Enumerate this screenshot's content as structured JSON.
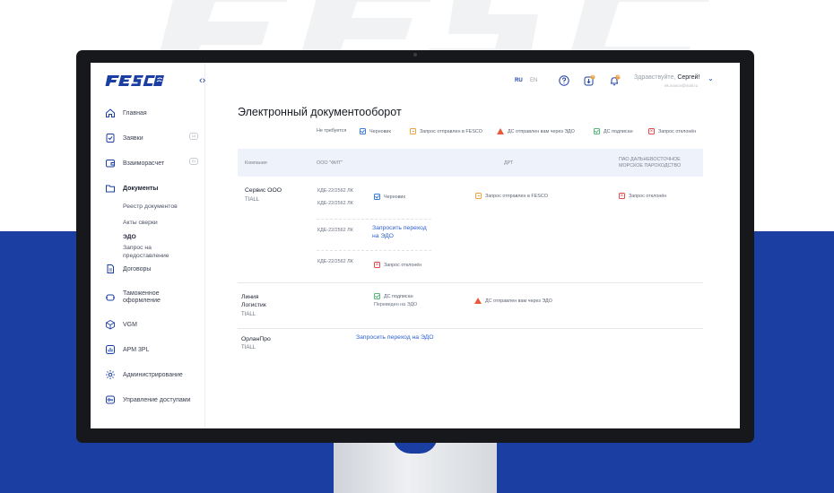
{
  "brand": {
    "logo_text": "FESCO",
    "bg_color": "#1b3ea3",
    "accent": "#2a5fd2"
  },
  "sidebar": {
    "items": [
      {
        "label": "Главная",
        "icon": "home-icon"
      },
      {
        "label": "Заявки",
        "icon": "document-check-icon",
        "badge": "14"
      },
      {
        "label": "Взаиморасчет",
        "icon": "wallet-icon",
        "badge": "21"
      },
      {
        "label": "Документы",
        "icon": "folder-icon"
      },
      {
        "label": "Договоры",
        "icon": "contract-icon"
      },
      {
        "label": "Таможенное оформление",
        "icon": "customs-icon"
      },
      {
        "label": "VGM",
        "icon": "cube-icon"
      },
      {
        "label": "АРМ 3PL",
        "icon": "chart-icon"
      },
      {
        "label": "Администрирование",
        "icon": "gear-icon"
      },
      {
        "label": "Управление доступами",
        "icon": "key-icon"
      }
    ],
    "documents_sub": [
      "Реестр документов",
      "Акты сверки",
      "ЭДО",
      "Запрос на предоставление"
    ]
  },
  "header": {
    "lang_ru": "RU",
    "lang_en": "EN",
    "help_icon": "question-icon",
    "tasks_icon": "download-icon",
    "tasks_badge": "5",
    "bell_icon": "bell-icon",
    "bell_badge": "15",
    "greeting_prefix": "Здравствуйте,",
    "user_name": "Сергей!",
    "user_email": "ek.ivanov@mail.ru"
  },
  "page_title": "Электронный документооборот",
  "legend": [
    "Не требуется",
    "Черновик",
    "Запрос отправлен в FESCO",
    "ДС отправлен вам через ЭДО",
    "ДС подписан",
    "Запрос отклонён"
  ],
  "table": {
    "headers": [
      "Компания",
      "ООО \"ФИТ\"",
      "ДРТ",
      "ПАО ДАЛЬНЕВОСТОЧНОЕ",
      "МОРСКОЕ ПАРОХОДСТВО"
    ],
    "row1": {
      "company": "Сервис ООО",
      "tag": "TIALL",
      "doc1": "КДЕ-22/2562 ЛК",
      "doc2": "КДЕ-22/2562 ЛК",
      "doc3": "КДЕ-22/2562 ЛК",
      "doc4": "КДЕ-22/2562 ЛК",
      "status_draft": "Черновик",
      "request_link_1": "Запросить переход",
      "request_link_2": "на ЭДО",
      "status_rejected": "Запрос отклонён",
      "drt_status": "Запрос отправлен в FESCO",
      "paro_status": "Запрос отклонён"
    },
    "row2": {
      "company_1": "Линия",
      "company_2": "Логистик",
      "tag": "TIALL",
      "status_signed": "ДС подписан",
      "moved": "Переведен на ЭДО",
      "drt_status": "ДС отправлен вам через ЭДО"
    },
    "row3": {
      "company": "ОрланПро",
      "tag": "TIALL",
      "request_link": "Запросить переход на ЭДО"
    }
  }
}
